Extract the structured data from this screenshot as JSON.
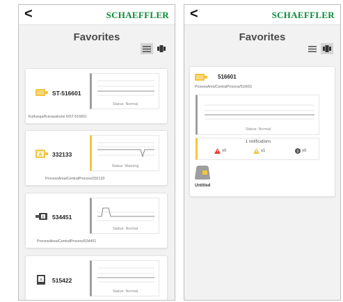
{
  "header": {
    "back_glyph": "<",
    "brand": "SCHAEFFLER"
  },
  "favorites": {
    "title": "Favorites",
    "icons": [
      "list-view-icon",
      "device-view-icon"
    ],
    "cards": [
      {
        "name": "ST-516601",
        "status": "Status: Normal",
        "path": "Kultuvuja/Kuivauskone 6/ST-516601",
        "status_color": "#9e9e9e"
      },
      {
        "name": "332133",
        "status": "Status: Warning",
        "path": "ProcessArea/CentralProcess/332133",
        "status_color": "#f4c542"
      },
      {
        "name": "534451",
        "status": "Status: Normal",
        "path": "ProcessArea/CentralProcess/534451",
        "status_color": "#9e9e9e"
      },
      {
        "name": "515422",
        "status": "Status: Normal",
        "path": "",
        "status_color": "#9e9e9e"
      }
    ]
  },
  "detail": {
    "title": "Favorites",
    "card": {
      "name": "516601",
      "path": "ProcessArea/CentralProcess/516601",
      "status": "Status: Normal",
      "notifications_title": "1 notifications",
      "counts": {
        "error": "x0",
        "warning": "x1",
        "info": "x0"
      }
    },
    "group": {
      "label": "Untitled"
    }
  },
  "colors": {
    "brand": "#0a8a3a",
    "warning": "#f4c542",
    "error": "#e53935",
    "info": "#555555"
  }
}
